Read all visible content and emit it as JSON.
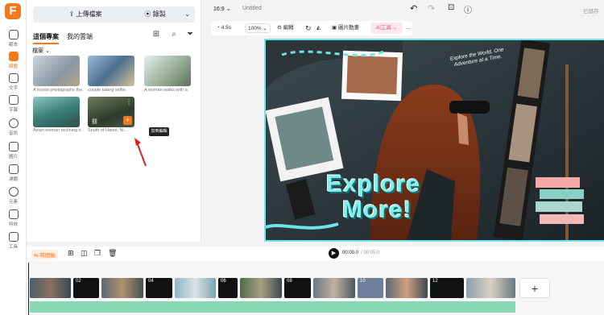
{
  "sidebar": {
    "items": [
      {
        "label": "範本",
        "icon": "template-icon"
      },
      {
        "label": "媒體",
        "icon": "media-icon",
        "active": true
      },
      {
        "label": "文字",
        "icon": "text-icon"
      },
      {
        "label": "字幕",
        "icon": "subtitle-icon"
      },
      {
        "label": "音訊",
        "icon": "audio-icon"
      },
      {
        "label": "圖片",
        "icon": "image-icon"
      },
      {
        "label": "濾鏡",
        "icon": "filter-icon"
      },
      {
        "label": "元素",
        "icon": "elements-icon"
      },
      {
        "label": "特效",
        "icon": "effects-icon"
      },
      {
        "label": "工具",
        "icon": "tools-icon"
      }
    ]
  },
  "panel": {
    "upload_label": "上傳檔案",
    "record_label": "錄製",
    "tabs": [
      "這個專案",
      "我的雲端"
    ],
    "section": "檔案",
    "media": [
      {
        "caption": "A tourist photographs the..."
      },
      {
        "caption": "couple taking selfie"
      },
      {
        "caption": "A woman walks with a"
      },
      {
        "caption": "Asian woman reclining o..."
      },
      {
        "caption": "South of Hanoi, Ni..."
      }
    ],
    "tooltip": "加到編輯"
  },
  "header": {
    "aspect": "16:9",
    "title": "Untitled",
    "status": "已儲存"
  },
  "toolbar": {
    "duration": "4.5s",
    "zoom": "100%",
    "edit": "編輯",
    "crop": "圖片動畫",
    "ai": "AI工具",
    "more": "..."
  },
  "canvas": {
    "headline1": "Explore",
    "headline2": "More!",
    "tagline": "Explore the World, One Adventure at a Time."
  },
  "timeline": {
    "label": "時間軸",
    "time_current": "00:00.0",
    "time_total": "/ 00:05.0",
    "clips": [
      {
        "num": ""
      },
      {
        "num": "02"
      },
      {
        "num": ""
      },
      {
        "num": "04"
      },
      {
        "num": ""
      },
      {
        "num": "06"
      },
      {
        "num": ""
      },
      {
        "num": "08"
      },
      {
        "num": ""
      },
      {
        "num": "10"
      },
      {
        "num": ""
      },
      {
        "num": "12"
      },
      {
        "num": ""
      }
    ]
  },
  "colors": {
    "accent": "#f47a20",
    "canvas_outline": "#6fe3e6",
    "headline": "#7ff0ec",
    "wave": "#6fd0a4"
  }
}
